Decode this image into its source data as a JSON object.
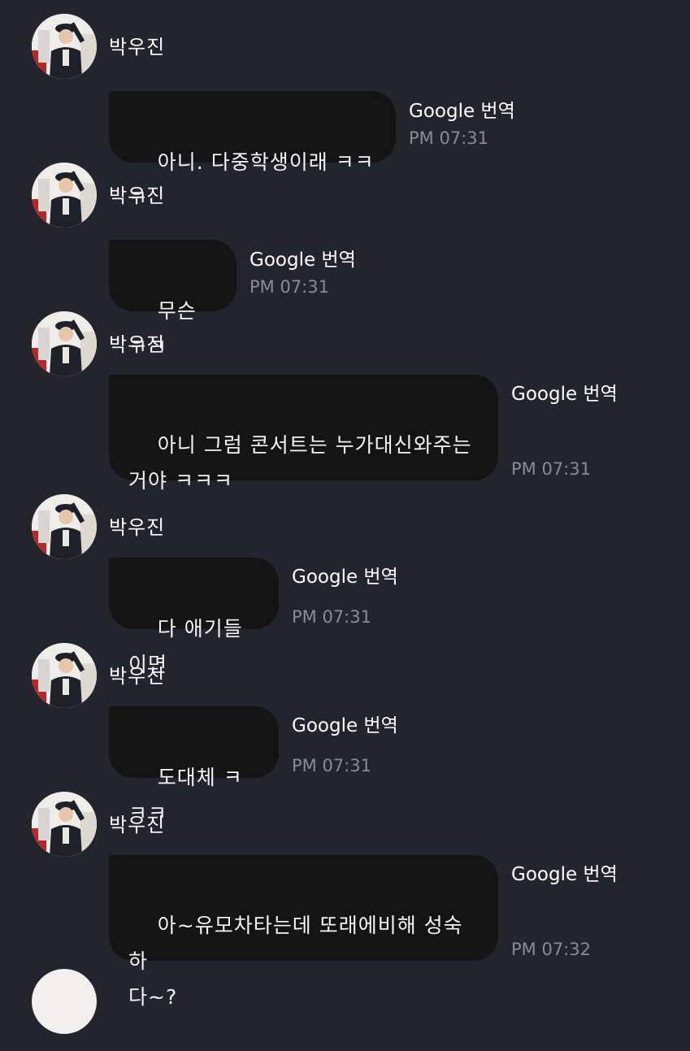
{
  "chat": {
    "messages": [
      {
        "sender": "박우진",
        "text": "아니. 다중학생이래 ㅋㅋㅋ",
        "translate_label": "Google 번역",
        "time": "PM 07:31"
      },
      {
        "sender": "박우진",
        "text": "무슨 ㅋㅋ",
        "translate_label": "Google 번역",
        "time": "PM 07:31"
      },
      {
        "sender": "박우진",
        "text": "아니 그럼 콘서트는 누가대신와주는\n거야 ㅋㅋㅋ",
        "translate_label": "Google 번역",
        "time": "PM 07:31"
      },
      {
        "sender": "박우진",
        "text": "다 애기들이면",
        "translate_label": "Google 번역",
        "time": "PM 07:31"
      },
      {
        "sender": "박우진",
        "text": "도대체 ㅋㅋㅋ",
        "translate_label": "Google 번역",
        "time": "PM 07:31"
      },
      {
        "sender": "박우진",
        "text": "아~유모차타는데 또래에비해 성숙하\n다~?",
        "translate_label": "Google 번역",
        "time": "PM 07:32"
      }
    ]
  },
  "colors": {
    "background": "#24242d",
    "bubble": "#141414",
    "timestamp": "#8a8a98"
  }
}
